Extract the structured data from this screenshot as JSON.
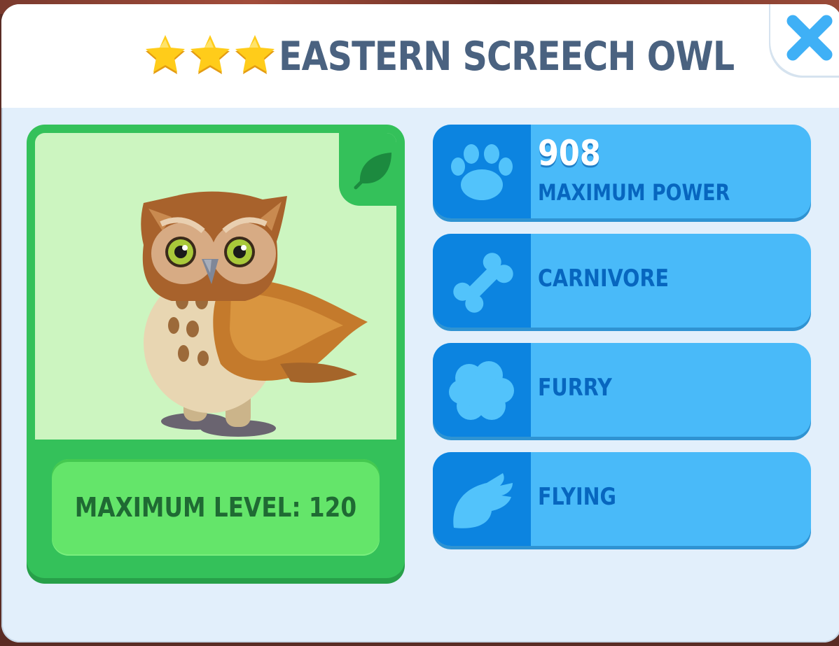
{
  "header": {
    "title": "EASTERN SCREECH OWL",
    "star_count": 3,
    "star_color": "#ffcc1a"
  },
  "close_button": {
    "icon": "close-icon",
    "color": "#3fb0f6"
  },
  "animal_card": {
    "portrait_icon": "owl-portrait",
    "badge_icon": "leaf-icon",
    "max_level_label": "MAXIMUM LEVEL: 120",
    "card_color": "#34c15a"
  },
  "stats": [
    {
      "icon": "paw-icon",
      "value": "908",
      "label": "MAXIMUM POWER"
    },
    {
      "icon": "bone-icon",
      "label": "CARNIVORE"
    },
    {
      "icon": "fur-icon",
      "label": "FURRY"
    },
    {
      "icon": "wing-icon",
      "label": "FLYING"
    }
  ],
  "colors": {
    "stat_bg": "#49baf9",
    "stat_icon_bg": "#0c84e0",
    "stat_text": "#0766bf",
    "title_text": "#4a6280"
  }
}
